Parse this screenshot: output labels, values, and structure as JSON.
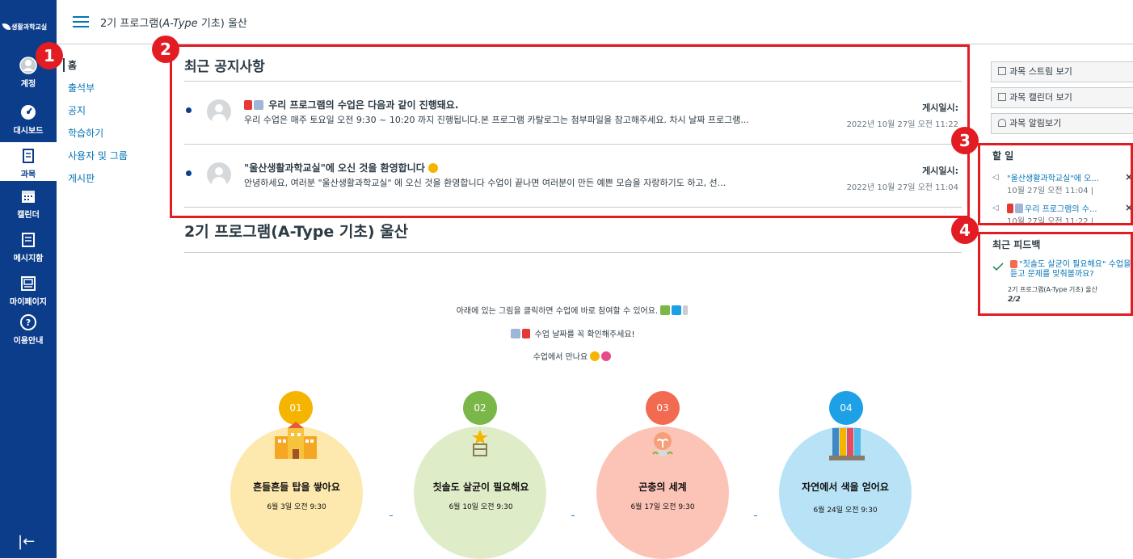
{
  "gnav": {
    "logo": "생활과학교실",
    "items": [
      {
        "label": "계정"
      },
      {
        "label": "대시보드"
      },
      {
        "label": "과목"
      },
      {
        "label": "캘린더"
      },
      {
        "label": "메시지함"
      },
      {
        "label": "마이페이지"
      },
      {
        "label": "이용안내"
      }
    ],
    "collapse": "|←"
  },
  "header": {
    "crumb_prefix": "2기 프로그램(",
    "crumb_italic": "A-Type",
    "crumb_suffix": " 기초) 울산"
  },
  "course_nav": [
    "홈",
    "출석부",
    "공지",
    "학습하기",
    "사용자 및 그룹",
    "게시판"
  ],
  "announcements": {
    "title": "최근 공지사항",
    "posted_label": "게시일시:",
    "items": [
      {
        "title": "우리 프로그램의 수업은 다음과 같이 진행돼요.",
        "body": "우리 수업은 매주 토요일 오전 9:30 ~ 10:20 까지 진행됩니다.본 프로그램 카탈로그는 첨부파일을 참고해주세요.  차시 날짜 프로그램...",
        "date": "2022년 10월 27일 오전 11:22"
      },
      {
        "title": "\"울산생활과학교실\"에 오신 것을 환영합니다",
        "body": "안녕하세요, 여러분 \"울산생활과학교실\" 에 오신 것을 환영합니다   수업이 끝나면 여러분이 만든 예쁜 모습을 자랑하기도 하고, 선...",
        "date": "2022년 10월 27일 오전 11:04"
      }
    ]
  },
  "course": {
    "heading": "2기 프로그램(A-Type 기초) 울산",
    "line1": "아래에 있는 그림을 클릭하면 수업에 바로 참여할 수 있어요.",
    "line2": "수업 날짜를 꼭 확인해주세요!",
    "line3": "수업에서 만나요",
    "sessions": [
      {
        "num": "01",
        "title": "흔들흔들 탑을 쌓아요",
        "date": "6월 3일 오전 9:30",
        "color": "#fde9ae",
        "num_color": "#f5b400"
      },
      {
        "num": "02",
        "title": "칫솔도 살균이 필요해요",
        "date": "6월 10일 오전 9:30",
        "color": "#dfecc8",
        "num_color": "#7ab648"
      },
      {
        "num": "03",
        "title": "곤충의 세계",
        "date": "6월 17일 오전 9:30",
        "color": "#fcc4b6",
        "num_color": "#f26b50"
      },
      {
        "num": "04",
        "title": "자연에서 색을 얻어요",
        "date": "6월 24일 오전 9:30",
        "color": "#b8e3f6",
        "num_color": "#1ea0e6"
      }
    ]
  },
  "right": {
    "buttons": [
      "과목 스트림 보기",
      "과목 캘린더 보기",
      "과목 알림보기"
    ],
    "todo_title": "할 일",
    "todos": [
      {
        "title": "\"울산생활과학교실\"에 오...",
        "date": "10월 27일 오전 11:04  |"
      },
      {
        "title": "우리 프로그램의 수...",
        "date": "10월 27일 오전 11:22  |"
      }
    ],
    "feedback_title": "최근 피드백",
    "feedback": {
      "title": "\"칫솔도 살균이 필요해요\" 수업을 듣고 문제를 맞춰볼까요?",
      "course": "2기 프로그램(A-Type 기초) 울산",
      "score": "2/2"
    }
  },
  "badges": [
    "1",
    "2",
    "3",
    "4"
  ]
}
